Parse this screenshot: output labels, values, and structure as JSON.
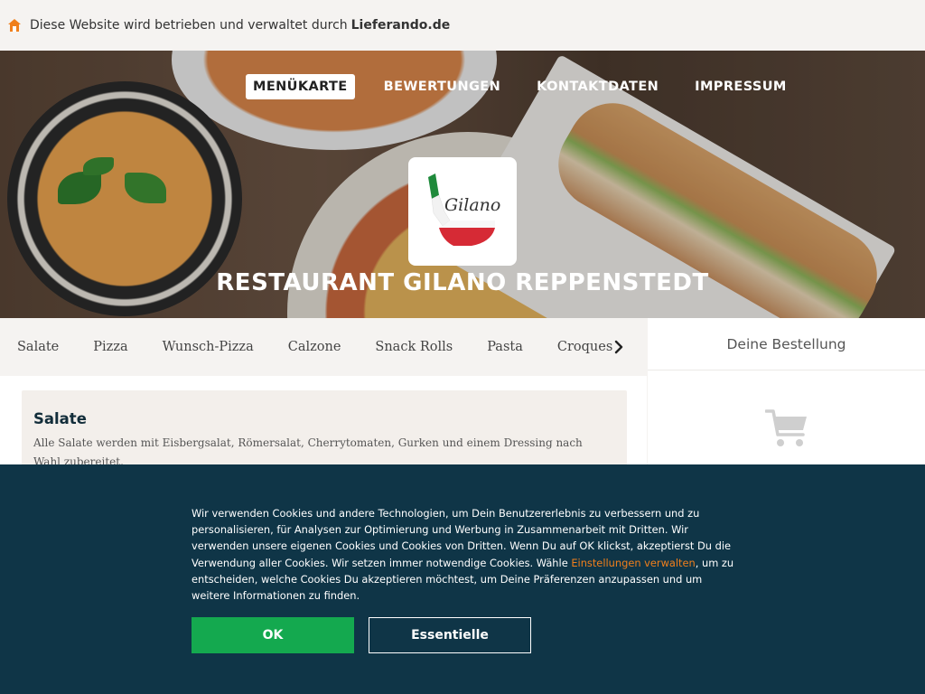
{
  "topbar": {
    "icon": "home-icon",
    "text": "Diese Website wird betrieben und verwaltet durch",
    "owner": "Lieferando.de"
  },
  "nav": {
    "items": [
      "MENÜKARTE",
      "BEWERTUNGEN",
      "KONTAKTDATEN",
      "IMPRESSUM"
    ]
  },
  "hero": {
    "logo_text": "Gilano",
    "restaurant_name": "RESTAURANT GILANO REPPENSTEDT"
  },
  "categories": [
    "Salate",
    "Pizza",
    "Wunsch-Pizza",
    "Calzone",
    "Snack Rolls",
    "Pasta",
    "Croques"
  ],
  "section": {
    "title": "Salate",
    "description": "Alle Salate werden mit Eisbergsalat, Römersalat, Cherrytomaten, Gurken und einem Dressing nach Wahl zubereitet."
  },
  "order": {
    "title": "Deine Bestellung"
  },
  "cookie": {
    "text_before": "Wir verwenden Cookies und andere Technologien, um Dein Benutzererlebnis zu verbessern und zu personalisieren, für Analysen zur Optimierung und Werbung in Zusammenarbeit mit Dritten. Wir verwenden unsere eigenen Cookies und Cookies von Dritten. Wenn Du auf OK klickst, akzeptierst Du die Verwendung aller Cookies. Wir setzen immer notwendige Cookies. Wähle ",
    "link": "Einstellungen verwalten",
    "text_after": ", um zu entscheiden, welche Cookies Du akzeptieren möchtest, um Deine Präferenzen anzupassen und um weitere Informationen zu finden.",
    "ok_label": "OK",
    "essential_label": "Essentielle"
  },
  "colors": {
    "accent_orange": "#f07f1c",
    "ok_green": "#14a94f",
    "banner_navy": "#0f3547"
  }
}
